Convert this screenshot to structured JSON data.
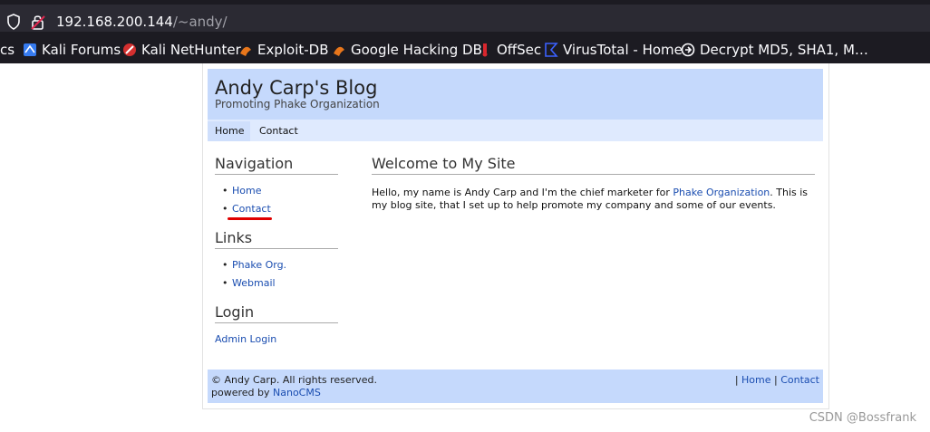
{
  "browser": {
    "url_host": "192.168.200.144",
    "url_path": "/~andy/",
    "bookmarks": [
      {
        "label": "cs",
        "icon": ""
      },
      {
        "label": "Kali Forums",
        "icon": "kali-forums-icon"
      },
      {
        "label": "Kali NetHunter",
        "icon": "kali-nethunter-icon"
      },
      {
        "label": "Exploit-DB",
        "icon": "exploit-db-icon"
      },
      {
        "label": "Google Hacking DB",
        "icon": "ghdb-icon"
      },
      {
        "label": "OffSec",
        "icon": "offsec-icon"
      },
      {
        "label": "VirusTotal - Home",
        "icon": "virustotal-icon"
      },
      {
        "label": "Decrypt MD5, SHA1, M…",
        "icon": "decrypt-icon"
      }
    ]
  },
  "site": {
    "title": "Andy Carp's Blog",
    "subtitle": "Promoting Phake Organization"
  },
  "topnav": {
    "home": "Home",
    "contact": "Contact"
  },
  "sidebar": {
    "navigation_heading": "Navigation",
    "navigation_items": [
      "Home",
      "Contact"
    ],
    "links_heading": "Links",
    "links_items": [
      "Phake Org.",
      "Webmail"
    ],
    "login_heading": "Login",
    "admin_login": "Admin Login"
  },
  "content": {
    "heading": "Welcome to My Site",
    "para_before": "Hello, my name is Andy Carp and I'm the chief marketer for ",
    "para_link": "Phake Organization",
    "para_after": ". This is my blog site, that I set up to help promote my company and some of our events."
  },
  "footer": {
    "copyright": "© Andy Carp. All rights reserved.",
    "powered_prefix": "powered by ",
    "powered_link": "NanoCMS",
    "sep1": "| ",
    "home": "Home",
    "sep2": " | ",
    "contact": "Contact"
  },
  "watermark": "CSDN @Bossfrank",
  "colors": {
    "header_bg": "#c5d9fc",
    "nav_bg": "#dfeafe",
    "link": "#1a4db0",
    "annotation": "#e00000"
  }
}
